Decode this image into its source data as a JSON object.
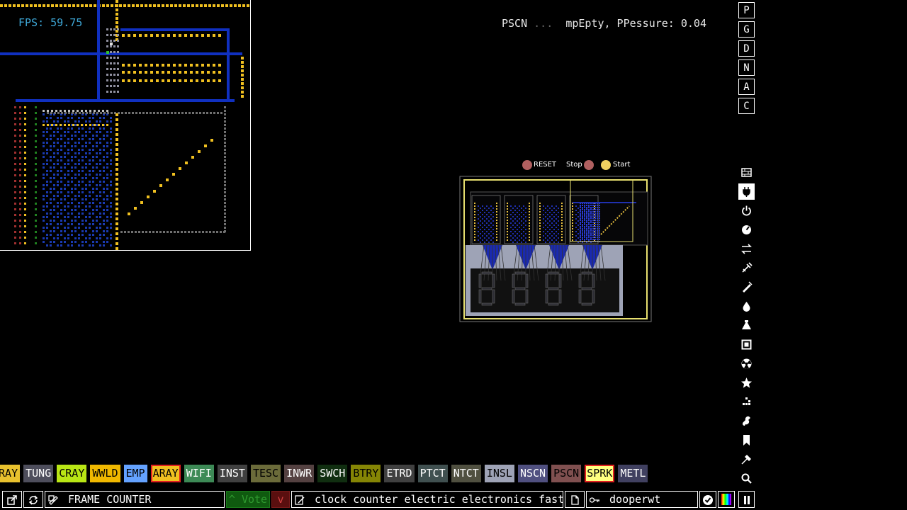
{
  "fps": "FPS: 59.75",
  "hud": {
    "prefix": "PSCN",
    "faded": " ...  ",
    "suffix": "mpEpty, PPessure: 0.04"
  },
  "save_labels": {
    "reset": "RESET",
    "stop": "Stop",
    "start": "Start"
  },
  "menu_letters": [
    "P",
    "G",
    "D",
    "N",
    "A",
    "C"
  ],
  "categories": [
    {
      "name": "walls-icon"
    },
    {
      "name": "electronics-icon",
      "active": true
    },
    {
      "name": "powered-icon"
    },
    {
      "name": "sensors-icon"
    },
    {
      "name": "force-icon"
    },
    {
      "name": "explosives-icon"
    },
    {
      "name": "gases-icon"
    },
    {
      "name": "liquids-icon"
    },
    {
      "name": "powders-icon"
    },
    {
      "name": "solids-icon"
    },
    {
      "name": "radioactive-icon"
    },
    {
      "name": "special-icon"
    },
    {
      "name": "game-of-life-icon"
    },
    {
      "name": "tools-icon"
    },
    {
      "name": "favorites-icon"
    },
    {
      "name": "decoration-icon"
    },
    {
      "name": "search-icon"
    }
  ],
  "elements": [
    {
      "label": "ARAY",
      "bg": "#e8c12e",
      "fg": "#000"
    },
    {
      "label": "TUNG",
      "bg": "#4e4e5c",
      "fg": "#fff"
    },
    {
      "label": "CRAY",
      "bg": "#b9e615",
      "fg": "#000"
    },
    {
      "label": "WWLD",
      "bg": "#f0b800",
      "fg": "#000"
    },
    {
      "label": "EMP",
      "bg": "#64a2ff",
      "fg": "#000"
    },
    {
      "label": "ARAY",
      "bg": "#f0c020",
      "fg": "#000",
      "selected": true
    },
    {
      "label": "WIFI",
      "bg": "#3d8a56",
      "fg": "#fff"
    },
    {
      "label": "INST",
      "bg": "#404040",
      "fg": "#fff"
    },
    {
      "label": "TESC",
      "bg": "#6b6b3a",
      "fg": "#000"
    },
    {
      "label": "INWR",
      "bg": "#544141",
      "fg": "#fff"
    },
    {
      "label": "SWCH",
      "bg": "#102e10",
      "fg": "#fff"
    },
    {
      "label": "BTRY",
      "bg": "#858505",
      "fg": "#000"
    },
    {
      "label": "ETRD",
      "bg": "#404040",
      "fg": "#fff"
    },
    {
      "label": "PTCT",
      "bg": "#405050",
      "fg": "#fff"
    },
    {
      "label": "NTCT",
      "bg": "#505040",
      "fg": "#fff"
    },
    {
      "label": "INSL",
      "bg": "#9ea3b6",
      "fg": "#000"
    },
    {
      "label": "NSCN",
      "bg": "#505080",
      "fg": "#fff"
    },
    {
      "label": "PSCN",
      "bg": "#805050",
      "fg": "#000"
    },
    {
      "label": "SPRK",
      "bg": "#ffff80",
      "fg": "#000",
      "selected": true
    },
    {
      "label": "METL",
      "bg": "#404060",
      "fg": "#fff"
    }
  ],
  "bottom": {
    "save_name": "FRAME COUNTER",
    "vote_label": "Vote",
    "tags": "clock counter electric electronics fast ...",
    "username": "dooperwt"
  }
}
